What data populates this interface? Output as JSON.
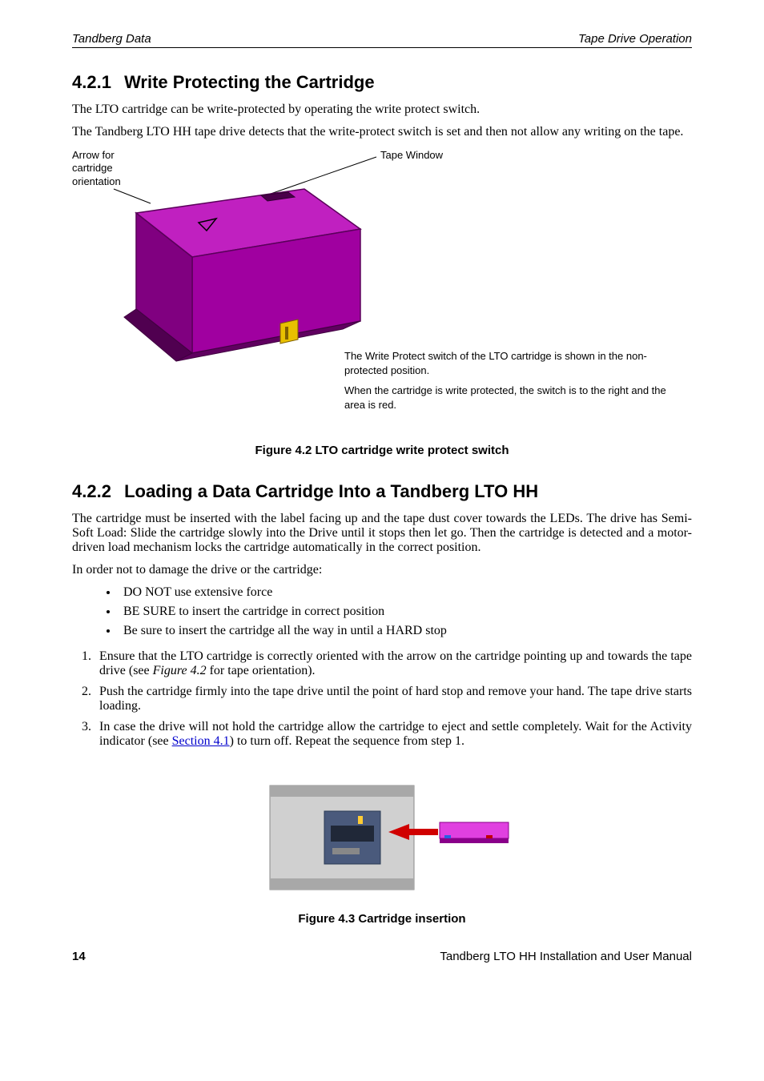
{
  "header": {
    "left": "Tandberg Data",
    "right": "Tape Drive Operation"
  },
  "sections": [
    {
      "num": "4.2.1",
      "title": "Write Protecting the Cartridge",
      "paras": [
        "The LTO cartridge can be write-protected by operating the write protect switch.",
        "The Tandberg LTO HH tape drive detects that the write-protect switch is set and then not allow any writing on the tape."
      ]
    },
    {
      "num": "4.2.2",
      "title": "Loading a Data Cartridge Into a Tandberg LTO HH",
      "paras": [
        "The cartridge must be inserted with the label facing up and the tape dust cover towards the LEDs. The drive has Semi-Soft Load: Slide the cartridge slowly into the Drive until it stops then let go. Then the cartridge is detected and a motor-driven load mechanism locks the cartridge automatically in the correct position.",
        "In order not to damage the drive or the cartridge:"
      ],
      "bullets": [
        "DO NOT use extensive force",
        "BE SURE to insert the cartridge in correct position",
        "Be sure to insert the cartridge all the way in until a HARD stop"
      ],
      "steps": [
        {
          "pre": "Ensure that the LTO cartridge is correctly oriented with the arrow on the cartridge pointing up and towards the tape drive (see ",
          "em": "Figure 4.2",
          "post": " for tape orientation)."
        },
        {
          "pre": "Push the cartridge firmly into the tape drive until the point of hard stop and remove your hand. The tape drive starts loading.",
          "em": "",
          "post": ""
        },
        {
          "pre": "In case the drive will not hold the cartridge allow the cartridge to eject and settle completely. Wait for the Activity indicator (see ",
          "link": "Section 4.1",
          "post": ") to turn off. Repeat the sequence from step 1."
        }
      ]
    }
  ],
  "figure1": {
    "label_arrow": "Arrow for\ncartridge\norientation",
    "label_window": "Tape Window",
    "note1": "The Write Protect switch of the LTO cartridge is shown in the non-protected position.",
    "note2": "When the cartridge is write protected, the switch is to the right and the area is red.",
    "caption": "Figure 4.2 LTO cartridge write protect switch"
  },
  "figure2": {
    "caption": "Figure 4.3 Cartridge insertion"
  },
  "footer": {
    "page": "14",
    "title": "Tandberg LTO HH Installation and User Manual"
  }
}
